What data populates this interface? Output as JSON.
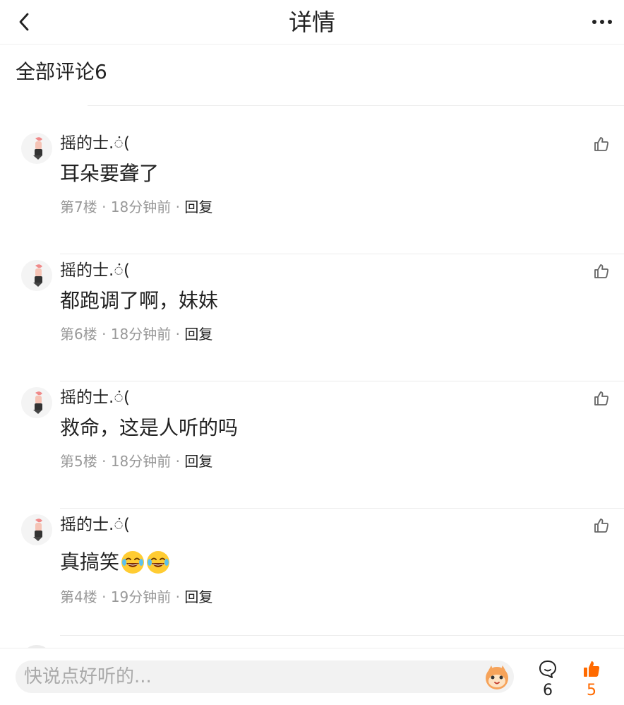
{
  "header": {
    "title": "详情",
    "back_icon": "back-chevron-icon",
    "more_icon": "more-dots-icon"
  },
  "comments_section": {
    "title": "全部评论6"
  },
  "comments": [
    {
      "user": "摇的士.ं(",
      "text": "耳朵要聋了",
      "emoji_count": 0,
      "floor": "第7楼",
      "time": "18分钟前",
      "reply_label": "回复",
      "meta_sep": " · "
    },
    {
      "user": "摇的士.ं(",
      "text": "都跑调了啊，妹妹",
      "emoji_count": 0,
      "floor": "第6楼",
      "time": "18分钟前",
      "reply_label": "回复",
      "meta_sep": " · "
    },
    {
      "user": "摇的士.ं(",
      "text": "救命，这是人听的吗",
      "emoji_count": 0,
      "floor": "第5楼",
      "time": "18分钟前",
      "reply_label": "回复",
      "meta_sep": " · "
    },
    {
      "user": "摇的士.ं(",
      "text": "真搞笑",
      "emoji_count": 2,
      "floor": "第4楼",
      "time": "19分钟前",
      "reply_label": "回复",
      "meta_sep": " · "
    }
  ],
  "bottom_bar": {
    "input_placeholder": "快说点好听的...",
    "comment_count": "6",
    "like_count": "5",
    "accent_color": "#ff6a00"
  }
}
